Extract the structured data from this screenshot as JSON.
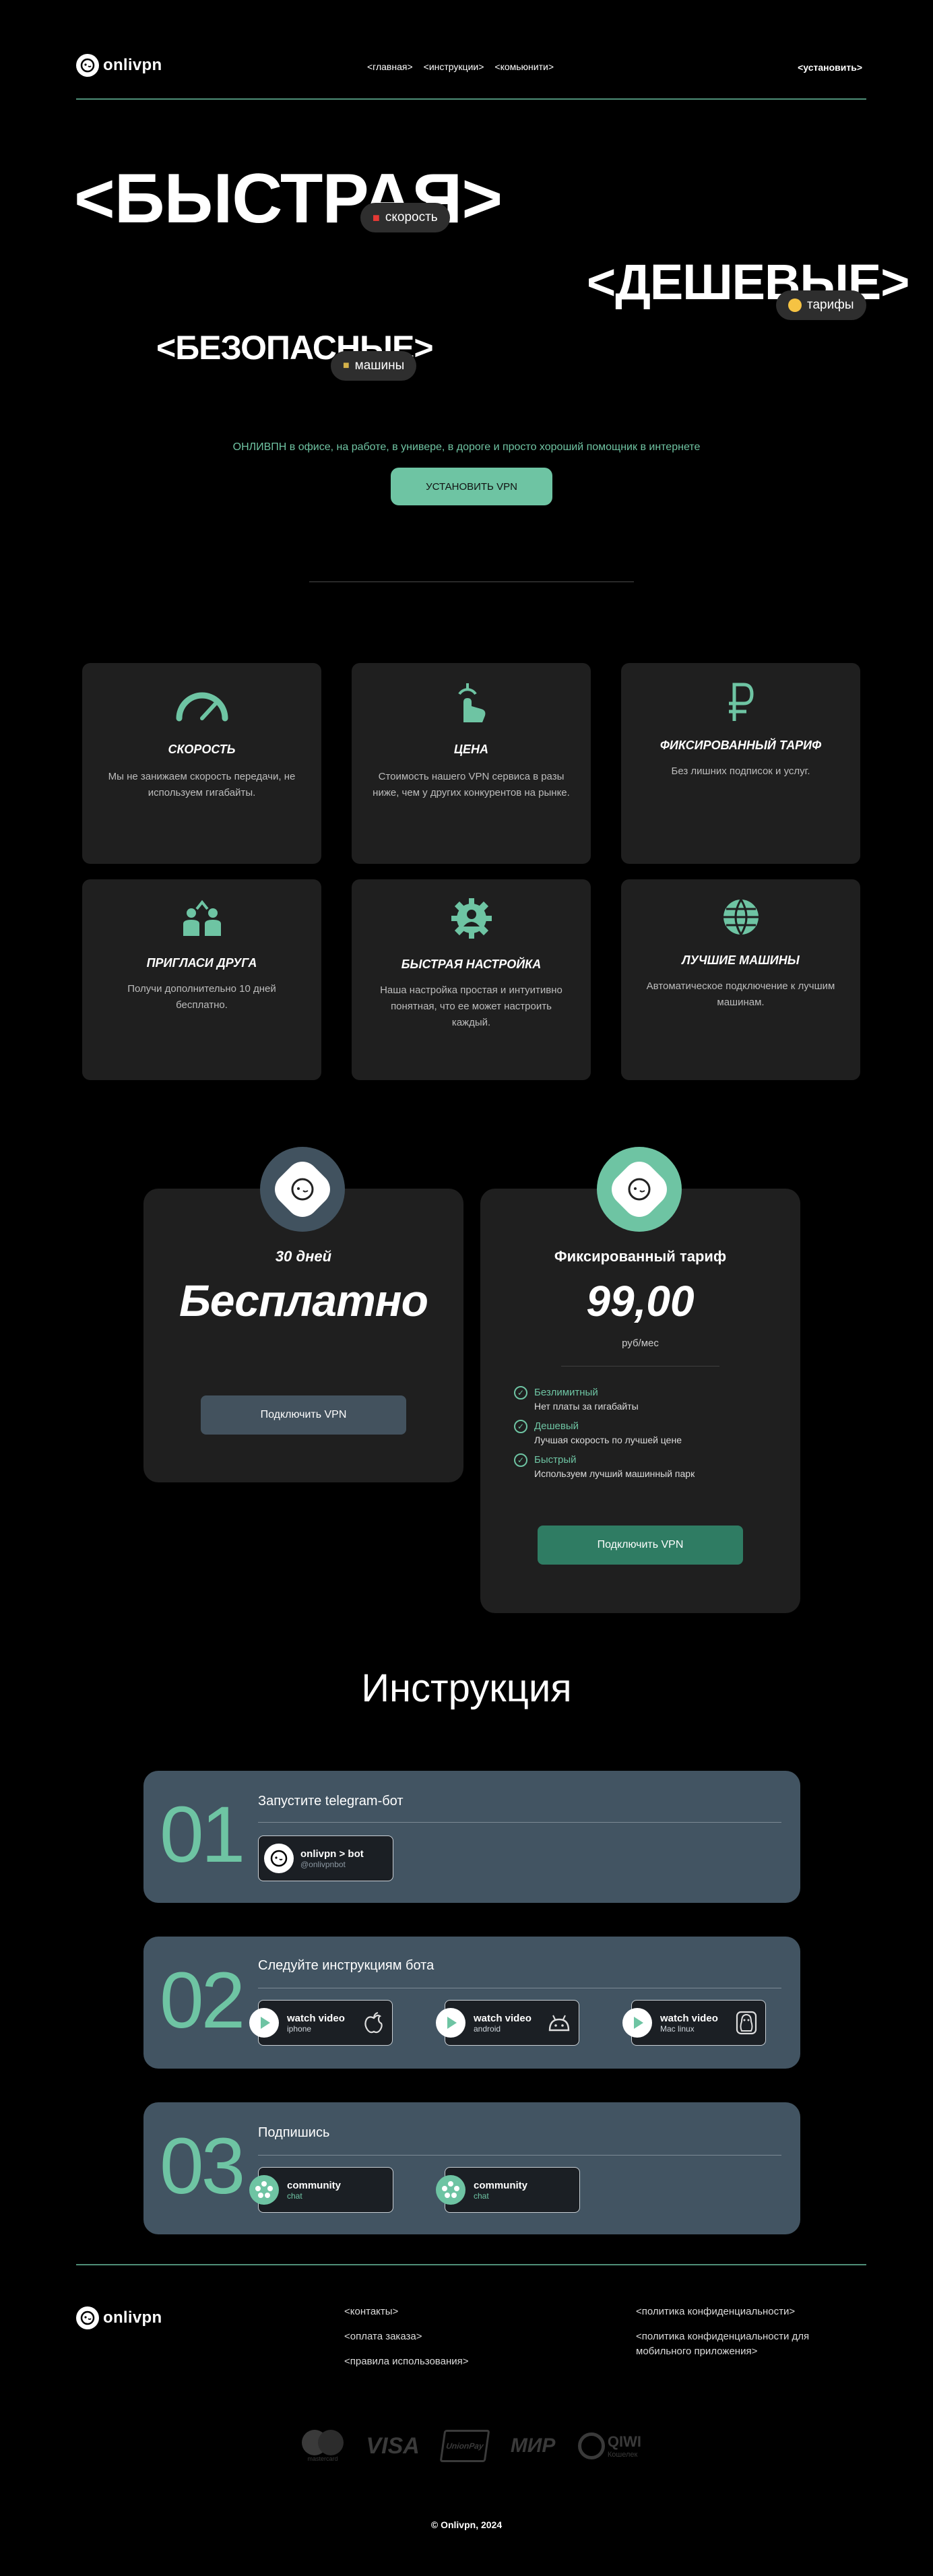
{
  "header": {
    "logo_text": "onlivpn",
    "nav": [
      "<главная>",
      "<инструкции>",
      "<комьюнити>"
    ],
    "install_link": "<установить>"
  },
  "hero": {
    "word1": "<БЫСТРАЯ>",
    "word2": "<ДЕШЕВЫЕ>",
    "word3": "<БЕЗОПАСНЫЕ>",
    "pill1": {
      "icon": "speed-car-icon",
      "label": "скорость"
    },
    "pill2": {
      "icon": "smile-emoji-icon",
      "label": "тарифы"
    },
    "pill3": {
      "icon": "lock-icon",
      "label": "машины"
    },
    "tagline": "ОНЛИВПН в офисе, на работе, в универе, в дороге и просто хороший помощник в интернете",
    "install_button": "УСТАНОВИТЬ VPN"
  },
  "features": [
    {
      "icon": "speedometer-icon",
      "title": "СКОРОСТЬ",
      "desc": "Мы не занижаем скорость передачи, не используем гигабайты."
    },
    {
      "icon": "tap-hand-icon",
      "title": "ЦЕНА",
      "desc": "Стоимость нашего VPN сервиса в разы ниже, чем у других конкурентов на рынке."
    },
    {
      "icon": "ruble-icon",
      "title": "ФИКСИРОВАННЫЙ ТАРИФ",
      "desc": "Без лишних подписок и услуг."
    },
    {
      "icon": "friends-icon",
      "title": "ПРИГЛАСИ ДРУГА",
      "desc": "Получи дополнительно 10 дней бесплатно."
    },
    {
      "icon": "gear-person-icon",
      "title": "БЫСТРАЯ НАСТРОЙКА",
      "desc": "Наша настройка простая и интуитивно понятная, что ее может настроить каждый."
    },
    {
      "icon": "globe-icon",
      "title": "ЛУЧШИЕ МАШИНЫ",
      "desc": "Автоматическое подключение к лучшим машинам."
    }
  ],
  "pricing": {
    "free": {
      "period": "30 дней",
      "price": "Бесплатно",
      "button": "Подключить VPN"
    },
    "paid": {
      "title": "Фиксированный тариф",
      "price": "99,00",
      "unit": "руб/мес",
      "features": [
        {
          "title": "Безлимитный",
          "desc": "Нет платы за гигабайты"
        },
        {
          "title": "Дешевый",
          "desc": "Лучшая скорость по лучшей цене"
        },
        {
          "title": "Быстрый",
          "desc": "Используем лучший машинный парк"
        }
      ],
      "button": "Подключить VPN"
    },
    "colors": {
      "free_avatar": "#41525f",
      "paid_avatar": "#6ec4a3"
    }
  },
  "instructions": {
    "heading": "Инструкция",
    "steps": [
      {
        "num": "01",
        "title": "Запустите telegram-бот",
        "tiles": [
          {
            "title": "onlivpn > bot",
            "sub": "@onlivpnbot",
            "icon": "telegram-bot-icon"
          }
        ]
      },
      {
        "num": "02",
        "title": "Следуйте инструкциям бота",
        "tiles": [
          {
            "title": "watch video",
            "sub": "iphone",
            "icon": "apple-icon"
          },
          {
            "title": "watch video",
            "sub": "android",
            "icon": "android-icon"
          },
          {
            "title": "watch video",
            "sub": "Mac linux",
            "icon": "linux-icon"
          }
        ]
      },
      {
        "num": "03",
        "title": "Подпишись",
        "tiles": [
          {
            "title": "community",
            "sub": "chat",
            "icon": "community-icon"
          },
          {
            "title": "community",
            "sub": "chat",
            "icon": "community-icon"
          }
        ]
      }
    ]
  },
  "footer": {
    "logo_text": "onlivpn",
    "col1": [
      "<контакты>",
      "<оплата заказа>",
      "<правила использования>"
    ],
    "col2": [
      "<политика конфиденциальности>",
      "<политика конфиденциальности для мобильного приложения>"
    ],
    "payments": [
      "mastercard",
      "VISA",
      "UnionPay",
      "МИР",
      "QIWI"
    ],
    "payments_sub": {
      "mastercard": "mastercard",
      "qiwi": "Кошелек"
    },
    "copyright": "© Onlivpn, 2024"
  },
  "colors": {
    "accent": "#6ec4a3",
    "card_bg": "#1f1f1f",
    "step_bg": "#425462"
  }
}
